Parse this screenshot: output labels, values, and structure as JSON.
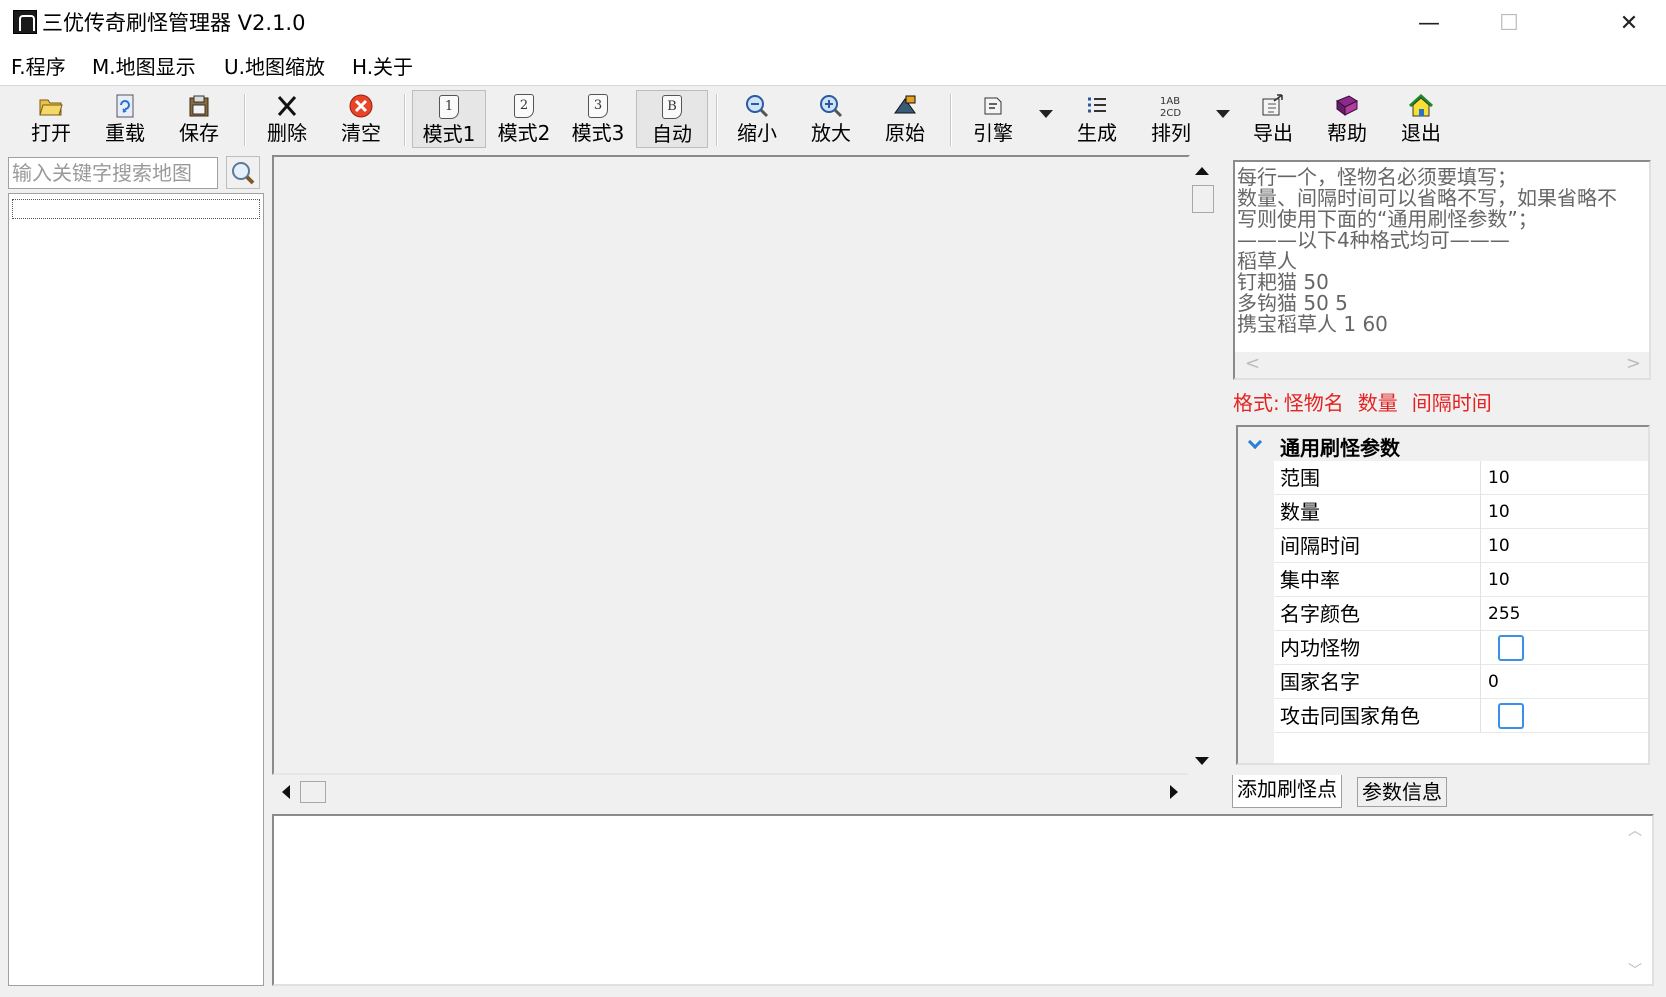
{
  "window": {
    "title": "三优传奇刷怪管理器 V2.1.0",
    "minimize": "—",
    "maximize": "☐",
    "close": "✕"
  },
  "menu": [
    "F.程序",
    "M.地图显示",
    "U.地图缩放",
    "H.关于"
  ],
  "toolbar": {
    "open": "打开",
    "reload": "重载",
    "save": "保存",
    "delete": "删除",
    "clear": "清空",
    "mode1": "模式1",
    "mode2": "模式2",
    "mode3": "模式3",
    "auto": "自动",
    "zoom_out": "缩小",
    "zoom_in": "放大",
    "original": "原始",
    "engine": "引擎",
    "generate": "生成",
    "sort": "排列",
    "export": "导出",
    "help": "帮助",
    "exit": "退出",
    "mode1_num": "1",
    "mode2_num": "2",
    "mode3_num": "3",
    "auto_letter": "B"
  },
  "search": {
    "placeholder": "输入关键字搜索地图"
  },
  "help_text": [
    "每行一个，怪物名必须要填写；",
    "数量、间隔时间可以省略不写，如果省略不",
    "写则使用下面的“通用刷怪参数”；",
    "———以下4种格式均可———",
    "稻草人",
    "钉耙猫 50",
    "多钩猫 50 5",
    "携宝稻草人 1 60"
  ],
  "format": {
    "label": "格式:",
    "name": "怪物名",
    "count": "数量",
    "interval": "间隔时间"
  },
  "properties": {
    "category": "通用刷怪参数",
    "rows": [
      {
        "name": "范围",
        "value": "10"
      },
      {
        "name": "数量",
        "value": "10"
      },
      {
        "name": "间隔时间",
        "value": "10"
      },
      {
        "name": "集中率",
        "value": "10"
      },
      {
        "name": "名字颜色",
        "value": "255"
      },
      {
        "name": "内功怪物",
        "checked": false
      },
      {
        "name": "国家名字",
        "value": "0"
      },
      {
        "name": "攻击同国家角色",
        "checked": false
      }
    ]
  },
  "tabs": {
    "add_point": "添加刷怪点",
    "param_info": "参数信息"
  },
  "colors": {
    "accent": "#2a7fd8",
    "format_red": "#e52222"
  }
}
